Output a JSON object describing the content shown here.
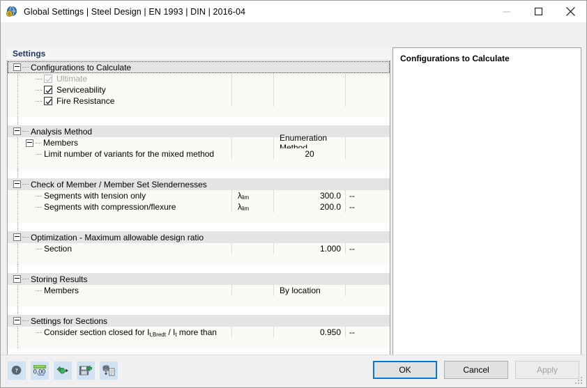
{
  "window": {
    "title": "Global Settings | Steel Design | EN 1993 | DIN | 2016-04",
    "icon": "app-globe-icon",
    "minimize_label": "—",
    "maximize_label": "□",
    "close_label": "✕"
  },
  "tab": {
    "label": "Settings"
  },
  "info_panel": {
    "title": "Configurations to Calculate"
  },
  "tree": {
    "groups": [
      {
        "label": "Configurations to Calculate",
        "focused": true,
        "rows": [
          {
            "type": "checkbox",
            "label": "Ultimate",
            "checked": true,
            "disabled": true,
            "symbol": "",
            "value": "",
            "unit": ""
          },
          {
            "type": "checkbox",
            "label": "Serviceability",
            "checked": true,
            "disabled": false,
            "symbol": "",
            "value": "",
            "unit": ""
          },
          {
            "type": "checkbox",
            "label": "Fire Resistance",
            "checked": true,
            "disabled": false,
            "symbol": "",
            "value": "",
            "unit": ""
          }
        ]
      },
      {
        "label": "Analysis Method",
        "focused": false,
        "rows": [
          {
            "type": "node",
            "label": "Members",
            "symbol": "",
            "value": "Enumeration Method",
            "value_align": "left",
            "unit": ""
          },
          {
            "type": "leaf",
            "label": "Limit number of variants for the mixed method",
            "symbol": "",
            "value": "20",
            "value_align": "center",
            "unit": ""
          }
        ]
      },
      {
        "label": "Check of Member / Member Set Slendernesses",
        "focused": false,
        "rows": [
          {
            "type": "leaf",
            "label": "Segments with tension only",
            "symbol_base": "λ",
            "symbol_sub": "lim",
            "value": "300.0",
            "unit": "--"
          },
          {
            "type": "leaf",
            "label": "Segments with compression/flexure",
            "symbol_base": "λ",
            "symbol_sub": "lim",
            "value": "200.0",
            "unit": "--"
          }
        ]
      },
      {
        "label": "Optimization - Maximum allowable design ratio",
        "focused": false,
        "rows": [
          {
            "type": "leaf",
            "label": "Section",
            "symbol": "",
            "value": "1.000",
            "unit": "--"
          }
        ]
      },
      {
        "label": "Storing Results",
        "focused": false,
        "rows": [
          {
            "type": "leaf",
            "label": "Members",
            "symbol": "",
            "value": "By location",
            "value_align": "left",
            "unit": ""
          }
        ]
      },
      {
        "label": "Settings for Sections",
        "focused": false,
        "rows": [
          {
            "type": "leaf_rich",
            "label_parts": [
              "Consider section closed for I",
              "t,Bredt",
              " / I",
              "t",
              " more than"
            ],
            "symbol": "",
            "value": "0.950",
            "unit": "--"
          }
        ]
      }
    ]
  },
  "toolbar": {
    "buttons": [
      {
        "name": "help-info-icon",
        "tooltip": "Info"
      },
      {
        "name": "number-format-icon",
        "tooltip": "0,00"
      },
      {
        "name": "import-settings-icon",
        "tooltip": "Import"
      },
      {
        "name": "save-settings-icon",
        "tooltip": "Save"
      },
      {
        "name": "database-report-icon",
        "tooltip": "Report"
      }
    ]
  },
  "buttons": {
    "ok": "OK",
    "cancel": "Cancel",
    "apply": "Apply"
  },
  "colors": {
    "accent": "#0078d7",
    "tab_text": "#1f3864",
    "group_row": "#e4e4e4",
    "item_row": "#fafaf7",
    "toolbtn_bg": "#cfe3f2"
  }
}
